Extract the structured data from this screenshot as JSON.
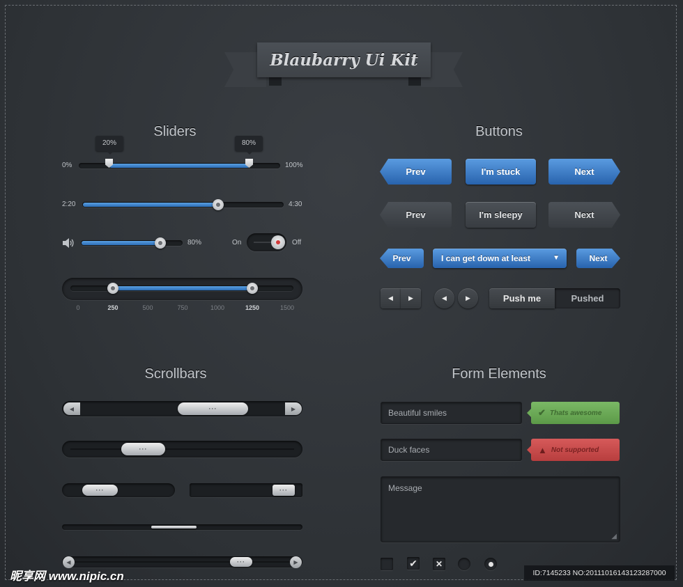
{
  "kit_title": "Blaubarry Ui Kit",
  "sections": {
    "sliders": "Sliders",
    "buttons": "Buttons",
    "scrollbars": "Scrollbars",
    "forms": "Form Elements"
  },
  "sliders": {
    "range1": {
      "min_label": "0%",
      "max_label": "100%",
      "low_tip": "20%",
      "high_tip": "80%",
      "low": 0.2,
      "high": 0.8
    },
    "player": {
      "start_label": "2:20",
      "end_label": "4:30",
      "progress": 0.54
    },
    "volume": {
      "level_label": "80%",
      "level": 0.8
    },
    "toggle": {
      "on_label": "On",
      "off_label": "Off"
    },
    "range2": {
      "low": 250,
      "high": 1250,
      "ticks": [
        "0",
        "250",
        "500",
        "750",
        "1000",
        "1250",
        "1500"
      ]
    }
  },
  "buttons": {
    "row1": {
      "prev": "Prev",
      "middle": "I'm stuck",
      "next": "Next"
    },
    "row2": {
      "prev": "Prev",
      "middle": "I'm sleepy",
      "next": "Next"
    },
    "row3": {
      "prev": "Prev",
      "dropdown": "I can get down at least",
      "next": "Next"
    },
    "segmented": {
      "push": "Push me",
      "pushed": "Pushed"
    }
  },
  "scrollbars": {
    "thumb_grip": "···"
  },
  "forms": {
    "field1": {
      "value": "Beautiful smiles",
      "status": "Thats awesome"
    },
    "field2": {
      "value": "Duck faces",
      "status": "Not supported"
    },
    "message_placeholder": "Message"
  },
  "watermark": {
    "logo": "昵享网 www.nipic.cn",
    "id_text": "ID:7145233 NO:20111016143123287000"
  },
  "colors": {
    "accent": "#3a7cc6",
    "success": "#6aab55",
    "error": "#c94a4a"
  }
}
